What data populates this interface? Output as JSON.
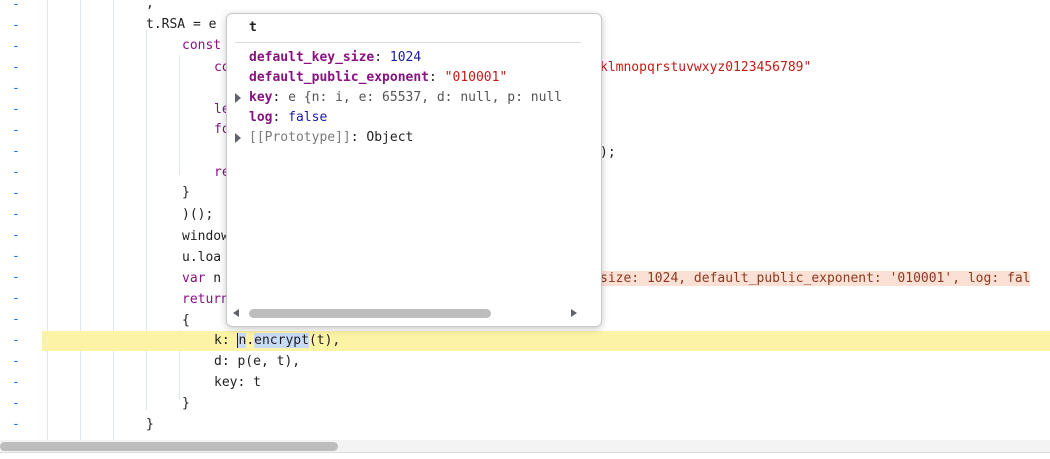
{
  "gutter": {
    "marker": "-"
  },
  "code": {
    "line_comma": ",",
    "line_rsa_prefix": "t.RSA = ",
    "line_rsa_tail": "e",
    "line_const": "const",
    "line_co": "co",
    "line_alphabet_tail": "klmnopqrstuvwxyz0123456789\"",
    "line_le": "le",
    "line_fo": "fo",
    "line_close_paren_tail": ");",
    "line_re": "re",
    "line_brace_close": "}",
    "line_iife": ")();",
    "line_window": "window",
    "line_uload": "u.loa",
    "line_var_kw": "var",
    "line_var_n": " n",
    "line_var_inline": "size: 1024, default_public_exponent: '010001', log: fal",
    "line_return_kw": "return",
    "line_open_brace": "{",
    "line_k_prefix": "k: ",
    "line_k_n": "n",
    "line_k_dot": ".",
    "line_k_method": "encrypt",
    "line_k_args": "(t),",
    "line_d": "d: p(e, t),",
    "line_key": "key: t",
    "line_inner_close": "}",
    "line_outer_close": "}"
  },
  "popover": {
    "title": "t",
    "rows": [
      {
        "key": "default_key_size",
        "sep": ": ",
        "value": "1024",
        "kind": "number",
        "expandable": false
      },
      {
        "key": "default_public_exponent",
        "sep": ": ",
        "value": "\"010001\"",
        "kind": "string",
        "expandable": false
      },
      {
        "key": "key",
        "sep": ": ",
        "value": "e {n: i, e: 65537, d: null, p: null",
        "kind": "object",
        "expandable": true
      },
      {
        "key": "log",
        "sep": ": ",
        "value": "false",
        "kind": "boolean",
        "expandable": false
      },
      {
        "key": "[[Prototype]]",
        "sep": ": ",
        "value": "Object",
        "kind": "object",
        "expandable": true
      }
    ]
  }
}
